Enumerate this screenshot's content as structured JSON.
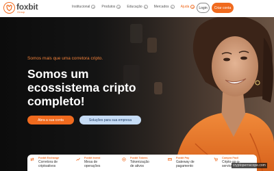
{
  "brand": {
    "name": "foxbit",
    "sub": "Group",
    "accent": "#f06a1e",
    "secondary_button_bg": "#c6dcf5"
  },
  "nav": {
    "items": [
      {
        "label": "Institucional",
        "active": false
      },
      {
        "label": "Produtos",
        "active": false
      },
      {
        "label": "Educação",
        "active": false
      },
      {
        "label": "Mercados",
        "active": false
      },
      {
        "label": "Ajuda",
        "active": true
      }
    ],
    "login_label": "Login",
    "signup_label": "Criar conta"
  },
  "hero": {
    "tagline": "Somos mais que uma corretora cripto.",
    "headline_lines": [
      "Somos um",
      "ecossistema cripto",
      "completo!"
    ],
    "cta_primary": "Abra a sua conta",
    "cta_secondary": "Soluções para sua empresa"
  },
  "products": [
    {
      "icon": "exchange-icon",
      "title": "Foxbit Exchange",
      "desc": "Corretora de criptoativos"
    },
    {
      "icon": "invest-icon",
      "title": "Foxbit Invest",
      "desc": "Mesa de operações"
    },
    {
      "icon": "token-icon",
      "title": "Foxbit Tokens",
      "desc": "Tokenização de ativos"
    },
    {
      "icon": "pay-icon",
      "title": "Foxbit Pay",
      "desc": "Gateway de pagamento"
    },
    {
      "icon": "compra-facil-icon",
      "title": "Compra Fácil",
      "desc": "Cripto-as-a-service"
    }
  ],
  "watermark": "cryptopernscope.com"
}
